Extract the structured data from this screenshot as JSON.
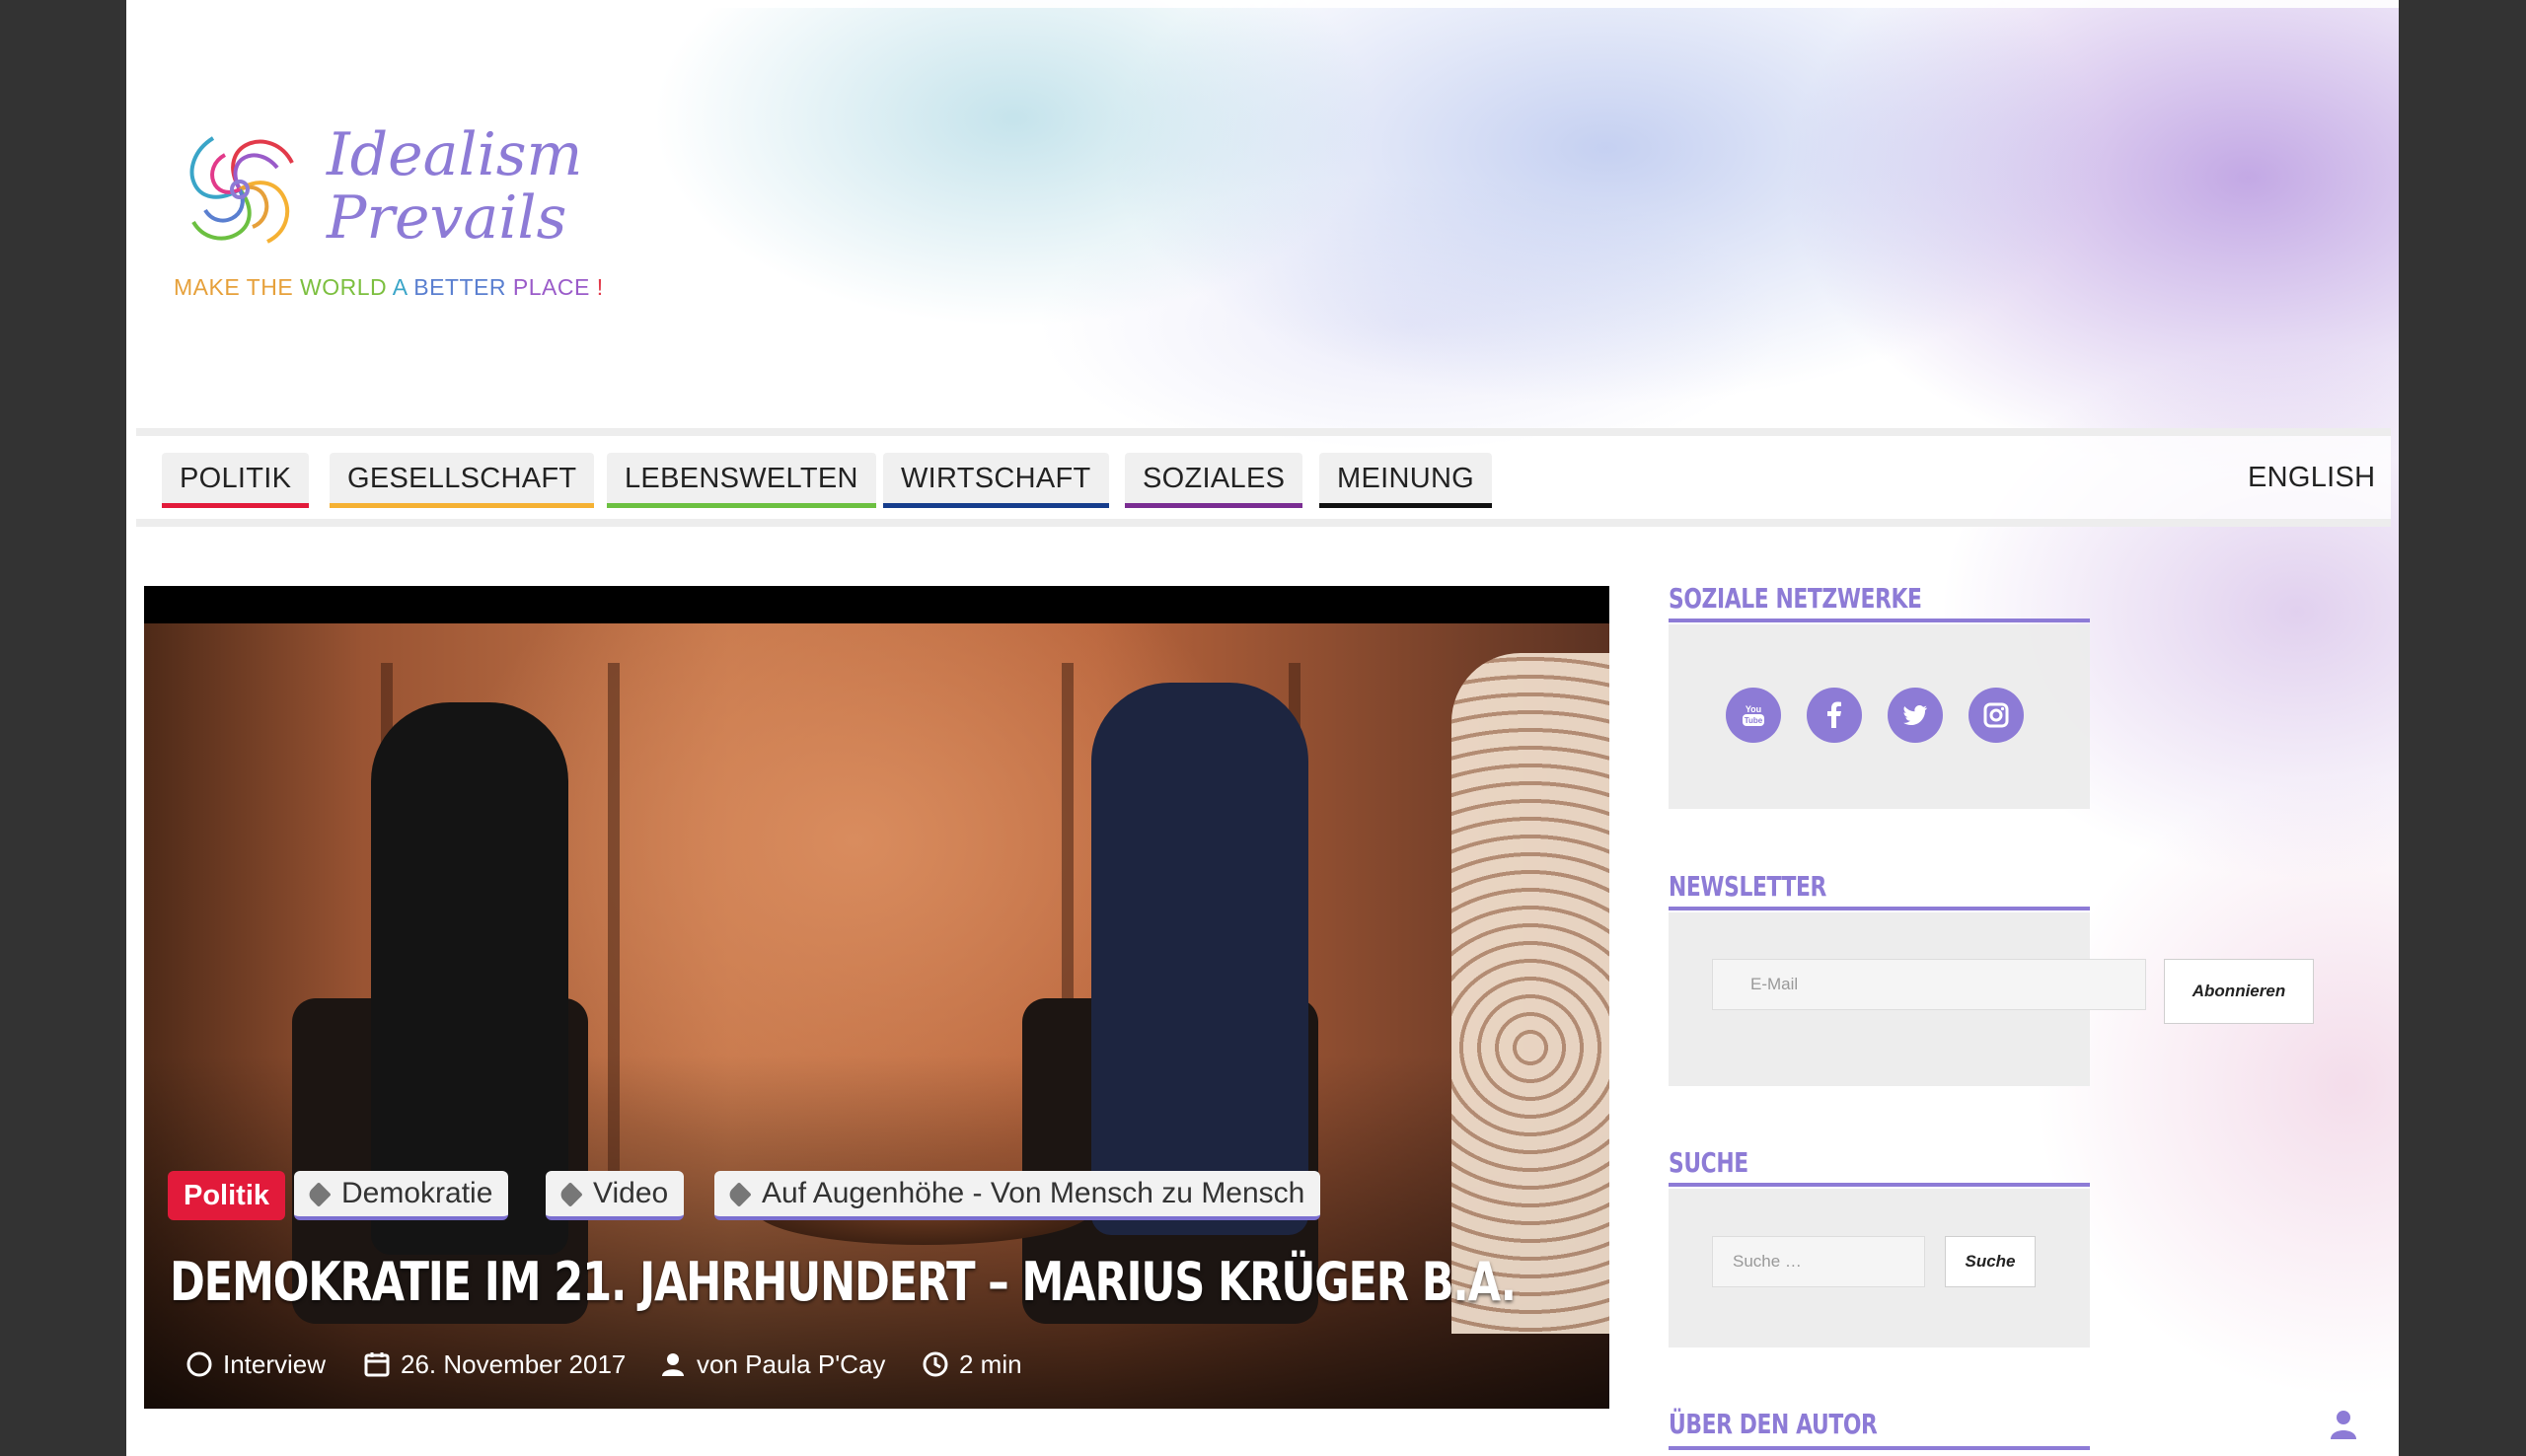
{
  "brand": {
    "name_line1": "Idealism",
    "name_line2": "Prevails",
    "tagline": [
      {
        "text": "MAKE ",
        "color": "#e6a03a"
      },
      {
        "text": "THE ",
        "color": "#e6a03a"
      },
      {
        "text": "WORLD ",
        "color": "#7cbf3f"
      },
      {
        "text": "A ",
        "color": "#3aa5c8"
      },
      {
        "text": "BETTER ",
        "color": "#5a7fd0"
      },
      {
        "text": "PLACE ",
        "color": "#9a5bc9"
      },
      {
        "text": "!",
        "color": "#e23a4a"
      }
    ]
  },
  "nav": {
    "items": [
      {
        "label": "POLITIK",
        "color": "#e21a3a"
      },
      {
        "label": "GESELLSCHAFT",
        "color": "#f5b133"
      },
      {
        "label": "LEBENSWELTEN",
        "color": "#6cc041"
      },
      {
        "label": "WIRTSCHAFT",
        "color": "#163d8c"
      },
      {
        "label": "SOZIALES",
        "color": "#7a2d92"
      },
      {
        "label": "MEINUNG",
        "color": "#111111"
      }
    ],
    "language": "ENGLISH"
  },
  "hero": {
    "category": "Politik",
    "tags": [
      "Demokratie",
      "Video",
      "Auf Augenhöhe - Von Mensch zu Mensch"
    ],
    "title": "DEMOKRATIE IM 21. JAHRHUNDERT – MARIUS KRÜGER B.A.",
    "meta": {
      "format": "Interview",
      "date": "26. November 2017",
      "author": "von Paula P'Cay",
      "reading_time": "2 min"
    }
  },
  "sidebar": {
    "social_title": "SOZIALE NETZWERKE",
    "social_icons": [
      "youtube-icon",
      "facebook-icon",
      "twitter-icon",
      "instagram-icon"
    ],
    "newsletter_title": "NEWSLETTER",
    "newsletter_placeholder": "E-Mail",
    "newsletter_button": "Abonnieren",
    "search_title": "SUCHE",
    "search_placeholder": "Suche …",
    "search_button": "Suche",
    "author_title": "ÜBER DEN AUTOR"
  },
  "colors": {
    "accent": "#8d7bd6",
    "category_red": "#e21a3a",
    "outer_background": "#333333"
  }
}
